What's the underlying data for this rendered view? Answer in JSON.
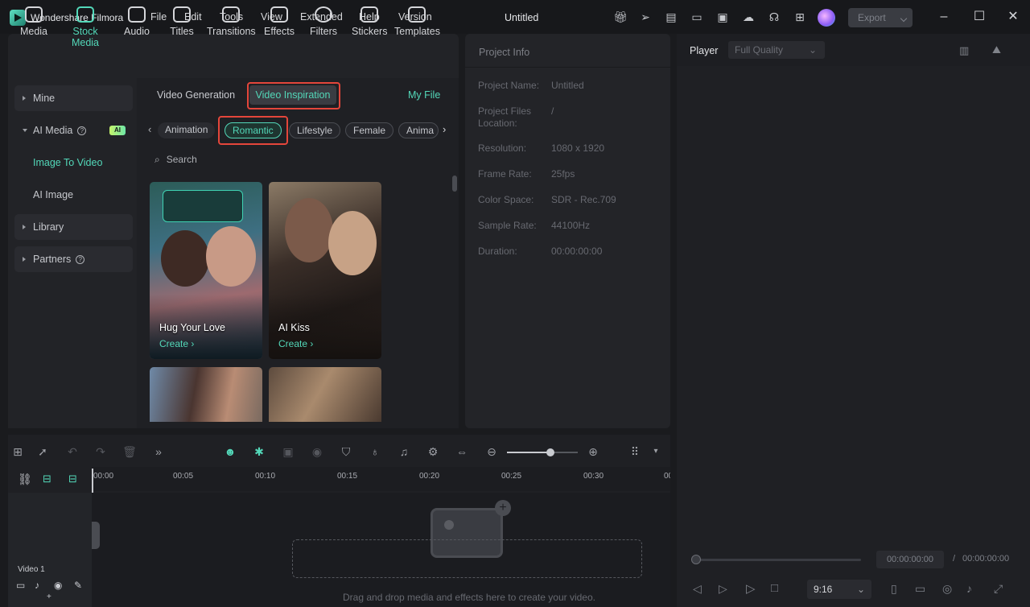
{
  "app": {
    "name": "Wondershare Filmora",
    "document_title": "Untitled",
    "export_label": "Export"
  },
  "menu": [
    "File",
    "Edit",
    "Tools",
    "View",
    "Extended",
    "Help",
    "Version"
  ],
  "toolbar": [
    {
      "label": "Media",
      "icon": "media-icon"
    },
    {
      "label": "Stock Media",
      "icon": "stock-media-icon",
      "active": true
    },
    {
      "label": "Audio",
      "icon": "audio-icon"
    },
    {
      "label": "Titles",
      "icon": "titles-icon"
    },
    {
      "label": "Transitions",
      "icon": "transitions-icon"
    },
    {
      "label": "Effects",
      "icon": "effects-icon"
    },
    {
      "label": "Filters",
      "icon": "filters-icon"
    },
    {
      "label": "Stickers",
      "icon": "stickers-icon"
    },
    {
      "label": "Templates",
      "icon": "templates-icon"
    }
  ],
  "sidebar": {
    "mine": "Mine",
    "ai_media": "AI Media",
    "ai_badge": "AI",
    "image_to_video": "Image To Video",
    "ai_image": "AI Image",
    "library": "Library",
    "partners": "Partners"
  },
  "content": {
    "tab_generation": "Video Generation",
    "tab_inspiration": "Video Inspiration",
    "my_file": "My File",
    "chips": [
      "Animation",
      "Romantic",
      "Lifestyle",
      "Female",
      "Anima"
    ],
    "search_placeholder": "Search",
    "cards": [
      {
        "title": "Hug Your Love",
        "action": "Create"
      },
      {
        "title": "AI Kiss",
        "action": "Create"
      }
    ]
  },
  "project_info": {
    "header": "Project Info",
    "rows": [
      {
        "label": "Project Name:",
        "value": "Untitled"
      },
      {
        "label": "Project Files Location:",
        "value": "/"
      },
      {
        "label": "Resolution:",
        "value": "1080 x 1920"
      },
      {
        "label": "Frame Rate:",
        "value": "25fps"
      },
      {
        "label": "Color Space:",
        "value": "SDR - Rec.709"
      },
      {
        "label": "Sample Rate:",
        "value": "44100Hz"
      },
      {
        "label": "Duration:",
        "value": "00:00:00:00"
      }
    ]
  },
  "player": {
    "title": "Player",
    "quality": "Full Quality",
    "current_time": "00:00:00:00",
    "separator": "/",
    "total_time": "00:00:00:00",
    "aspect": "9:16"
  },
  "timeline": {
    "ruler": [
      "00:00",
      "00:05",
      "00:10",
      "00:15",
      "00:20",
      "00:25",
      "00:30",
      "00:"
    ],
    "track_name": "Video 1",
    "drop_hint": "Drag and drop media and effects here to create your video."
  },
  "colors": {
    "accent": "#53d8b9",
    "highlight": "#e4463b"
  }
}
